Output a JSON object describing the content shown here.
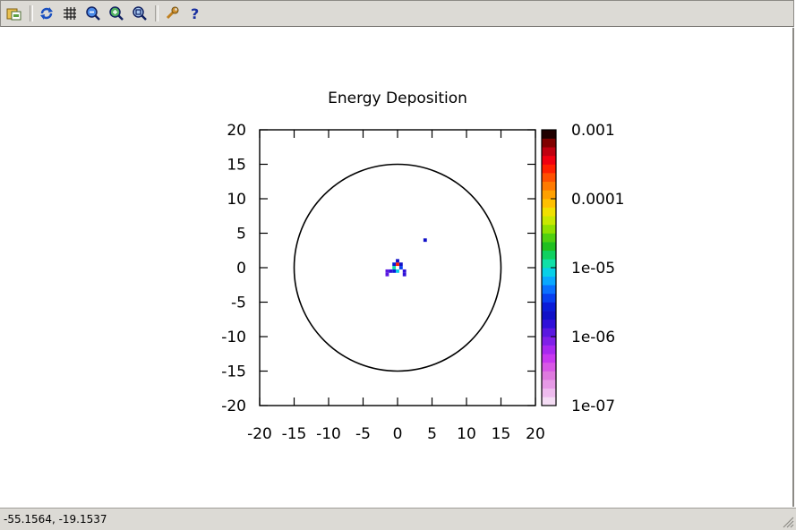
{
  "toolbar": {
    "buttons": [
      {
        "icon": "open-folder-icon"
      },
      {
        "icon": "refresh-icon"
      },
      {
        "icon": "grid-icon"
      },
      {
        "icon": "zoom-in-icon"
      },
      {
        "icon": "zoom-out-icon"
      },
      {
        "icon": "zoom-fit-icon"
      },
      {
        "icon": "wrench-icon"
      },
      {
        "icon": "help-icon"
      }
    ]
  },
  "chart_data": {
    "type": "heatmap",
    "title": "Energy Deposition",
    "xlabel": "",
    "ylabel": "",
    "xlim": [
      -20,
      20
    ],
    "ylim": [
      -20,
      20
    ],
    "x_ticks": [
      "-20",
      "-15",
      "-10",
      "-5",
      "0",
      "5",
      "10",
      "15",
      "20"
    ],
    "y_ticks": [
      "20",
      "15",
      "10",
      "5",
      "0",
      "-5",
      "-10",
      "-15",
      "-20"
    ],
    "colorbar": {
      "scale": "log",
      "range": [
        1e-07,
        0.001
      ],
      "tick_labels": [
        "0.001",
        "0.0001",
        "1e-05",
        "1e-06",
        "1e-07"
      ],
      "colors": [
        "#f4dcf4",
        "#eebbee",
        "#e69ae6",
        "#de7ade",
        "#d858e6",
        "#c838f0",
        "#a828f0",
        "#8020e8",
        "#5a18e0",
        "#3010d8",
        "#1010c8",
        "#0a1cd8",
        "#0840f0",
        "#0a70ff",
        "#0aa8ff",
        "#08d0e8",
        "#10e0a8",
        "#10d060",
        "#20c020",
        "#50d010",
        "#90e000",
        "#c8e800",
        "#f0e000",
        "#ffc000",
        "#ffa000",
        "#ff7a00",
        "#ff5000",
        "#ff2000",
        "#f00010",
        "#c00010",
        "#800000",
        "#200000"
      ]
    },
    "circle": {
      "center": [
        0,
        0
      ],
      "radius": 15
    },
    "cells": [
      {
        "x": 0,
        "y": 0.5,
        "value": 0.0003
      },
      {
        "x": 0,
        "y": 1,
        "value": 2e-06
      },
      {
        "x": -0.5,
        "y": 0,
        "value": 1e-05
      },
      {
        "x": 0.5,
        "y": 0,
        "value": 4e-06
      },
      {
        "x": -0.5,
        "y": 0.5,
        "value": 3e-06
      },
      {
        "x": 0.5,
        "y": 0.5,
        "value": 2e-06
      },
      {
        "x": -1,
        "y": -0.5,
        "value": 1.5e-06
      },
      {
        "x": 1,
        "y": -0.5,
        "value": 1.5e-06
      },
      {
        "x": -1.5,
        "y": -0.5,
        "value": 1e-06
      },
      {
        "x": -1.5,
        "y": -1,
        "value": 1e-06
      },
      {
        "x": 1,
        "y": -1,
        "value": 1.5e-06
      },
      {
        "x": 0,
        "y": -0.5,
        "value": 8e-06
      },
      {
        "x": -0.5,
        "y": -0.5,
        "value": 3e-06
      },
      {
        "x": 4,
        "y": 4,
        "value": 2e-06
      }
    ]
  },
  "status": {
    "coords": "-55.1564, -19.1537"
  }
}
